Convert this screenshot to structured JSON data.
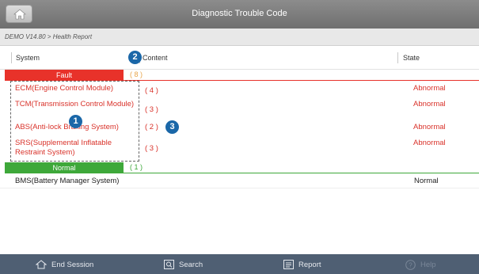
{
  "header": {
    "title": "Diagnostic Trouble Code",
    "home_icon": "home-icon"
  },
  "breadcrumb": "DEMO V14.80 > Health Report",
  "columns": {
    "system": "System",
    "content": "Content",
    "state": "State"
  },
  "callouts": [
    "1",
    "2",
    "3"
  ],
  "fault_group": {
    "label": "Fault",
    "count": "( 8 )",
    "color": "#e8322a"
  },
  "fault_rows": [
    {
      "system": "ECM(Engine Control Module)",
      "count": "( 4 )",
      "state": "Abnormal"
    },
    {
      "system": "TCM(Transmission Control Module)",
      "count": "( 3 )",
      "state": "Abnormal"
    },
    {
      "system": "ABS(Anti-lock Braking System)",
      "count": "( 2 )",
      "state": "Abnormal"
    },
    {
      "system": "SRS(Supplemental Inflatable Restraint System)",
      "count": "( 3 )",
      "state": "Abnormal"
    }
  ],
  "normal_group": {
    "label": "Normal",
    "count": "( 1 )",
    "color": "#3ea83a"
  },
  "normal_rows": [
    {
      "system": "BMS(Battery Manager System)",
      "state": "Normal"
    }
  ],
  "toolbar": {
    "end_session": {
      "label": "End Session",
      "icon": "home-outline-icon"
    },
    "search": {
      "label": "Search",
      "icon": "search-icon"
    },
    "report": {
      "label": "Report",
      "icon": "report-icon"
    },
    "help": {
      "label": "Help",
      "icon": "help-icon"
    }
  }
}
